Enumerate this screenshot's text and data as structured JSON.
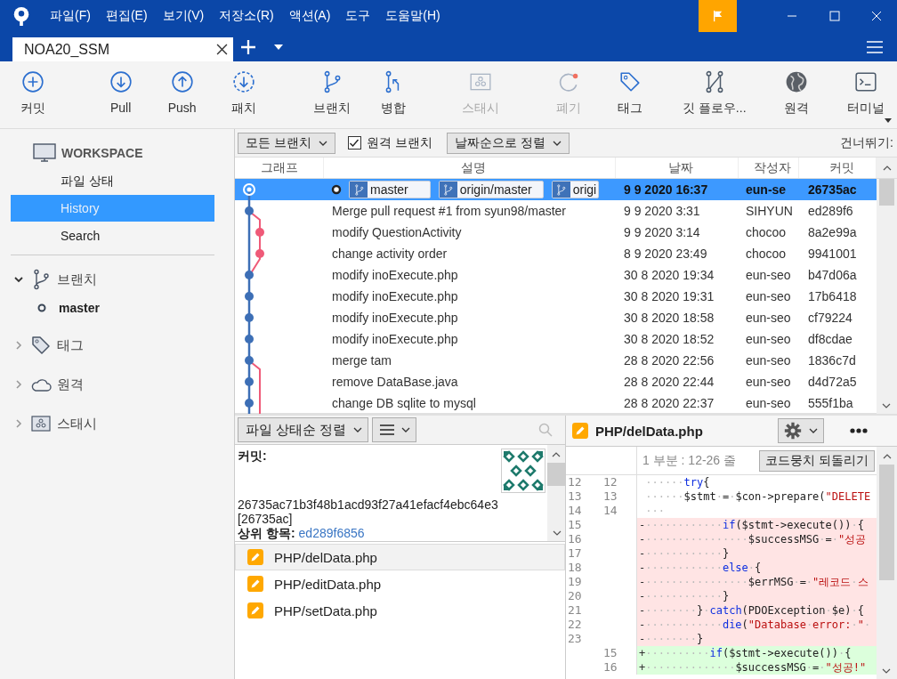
{
  "title_bar": {
    "menus": [
      "파일(F)",
      "편집(E)",
      "보기(V)",
      "저장소(R)",
      "액션(A)",
      "도구",
      "도움말(H)"
    ]
  },
  "tabs": [
    {
      "label": "NOA20_SSM",
      "selected": true
    }
  ],
  "toolbar": [
    {
      "kind": "commit",
      "label": "커밋",
      "disabled": false
    },
    {
      "kind": "pull",
      "label": "Pull",
      "disabled": false
    },
    {
      "kind": "push",
      "label": "Push",
      "disabled": false
    },
    {
      "kind": "patch",
      "label": "패치",
      "disabled": false
    },
    {
      "kind": "branch",
      "label": "브랜치",
      "disabled": false
    },
    {
      "kind": "merge",
      "label": "병합",
      "disabled": false
    },
    {
      "kind": "stash",
      "label": "스태시",
      "disabled": true
    },
    {
      "kind": "discard",
      "label": "폐기",
      "disabled": true
    },
    {
      "kind": "tag",
      "label": "태그",
      "disabled": false
    },
    {
      "kind": "gitflow",
      "label": "깃 플로우...",
      "disabled": false
    },
    {
      "kind": "remote",
      "label": "원격",
      "disabled": false
    },
    {
      "kind": "terminal",
      "label": "터미널",
      "disabled": false
    }
  ],
  "sidebar": {
    "workspace": {
      "title": "WORKSPACE",
      "items": [
        {
          "label": "파일 상태",
          "selected": false
        },
        {
          "label": "History",
          "selected": true
        },
        {
          "label": "Search",
          "selected": false
        }
      ]
    },
    "groups": [
      {
        "kind": "branches",
        "label": "브랜치",
        "expanded": true,
        "children": [
          {
            "label": "master",
            "current": true
          }
        ]
      },
      {
        "kind": "tags",
        "label": "태그",
        "expanded": false
      },
      {
        "kind": "remotes",
        "label": "원격",
        "expanded": false
      },
      {
        "kind": "stashes",
        "label": "스태시",
        "expanded": false
      }
    ]
  },
  "filter_bar": {
    "branch_filter": "모든 브랜치",
    "remote_branches": {
      "label": "원격 브랜치",
      "checked": true
    },
    "sort": "날짜순으로 정렬",
    "jump_label": "건너뛰기:"
  },
  "commit_table": {
    "columns": [
      "그래프",
      "설명",
      "날짜",
      "작성자",
      "커밋"
    ],
    "rows": [
      {
        "selected": true,
        "head": true,
        "refs": [
          "master",
          "origin/master",
          "origi"
        ],
        "date": "9 9 2020 16:37",
        "author": "eun-se",
        "commit": "26735ac"
      },
      {
        "selected": false,
        "description": "Merge pull request #1 from syun98/master",
        "date": "9 9 2020 3:31",
        "author": "SIHYUN",
        "commit": "ed289f6"
      },
      {
        "selected": false,
        "description": "modify QuestionActivity",
        "date": "9 9 2020 3:14",
        "author": "chocoo",
        "commit": "8a2e99a"
      },
      {
        "selected": false,
        "description": "change activity order",
        "date": "8 9 2020 23:49",
        "author": "chocoo",
        "commit": "9941001"
      },
      {
        "selected": false,
        "description": "modify inoExecute.php",
        "date": "30 8 2020 19:34",
        "author": "eun-seo",
        "commit": "b47d06a"
      },
      {
        "selected": false,
        "description": "modify inoExecute.php",
        "date": "30 8 2020 19:31",
        "author": "eun-seo",
        "commit": "17b6418"
      },
      {
        "selected": false,
        "description": "modify inoExecute.php",
        "date": "30 8 2020 18:58",
        "author": "eun-seo",
        "commit": "cf79224"
      },
      {
        "selected": false,
        "description": "modify inoExecute.php",
        "date": "30 8 2020 18:52",
        "author": "eun-seo",
        "commit": "df8cdae"
      },
      {
        "selected": false,
        "description": "merge tam",
        "date": "28 8 2020 22:56",
        "author": "eun-seo",
        "commit": "1836c7d"
      },
      {
        "selected": false,
        "description": "remove DataBase.java",
        "date": "28 8 2020 22:44",
        "author": "eun-seo",
        "commit": "d4d72a5"
      },
      {
        "selected": false,
        "description": "change DB sqlite to mysql",
        "date": "28 8 2020 22:37",
        "author": "eun-seo",
        "commit": "555f1ba"
      }
    ]
  },
  "details": {
    "sort": "파일 상태순 정렬",
    "commit_label": "커밋:",
    "hash": "26735ac71b3f48b1acd93f27a41efacf4ebc64e3 [26735ac]",
    "parent_label": "상위 항목:",
    "parent": "ed289f6856",
    "files": [
      {
        "path": "PHP/delData.php",
        "selected": true
      },
      {
        "path": "PHP/editData.php",
        "selected": false
      },
      {
        "path": "PHP/setData.php",
        "selected": false
      }
    ]
  },
  "diff": {
    "file": "PHP/delData.php",
    "hunk": "1 부분 : 12-26 줄",
    "revert_button": "코드뭉치 되돌리기",
    "lines": [
      {
        "kind": "context",
        "old": "12",
        "new": "12",
        "tokens": [
          {
            "text": "······",
            "kind": "plain"
          },
          {
            "text": "try",
            "kind": "keyword"
          },
          {
            "text": "{",
            "kind": "plain"
          }
        ]
      },
      {
        "kind": "context",
        "old": "13",
        "new": "13",
        "tokens": [
          {
            "text": "······$stmt·=·$con->prepare(",
            "kind": "plain"
          },
          {
            "text": "\"DELETE",
            "kind": "string"
          }
        ]
      },
      {
        "kind": "context",
        "old": "14",
        "new": "14",
        "tokens": [
          {
            "text": "···",
            "kind": "plain"
          }
        ]
      },
      {
        "kind": "removed",
        "old": "15",
        "sign": "-",
        "tokens": [
          {
            "text": "············",
            "kind": "plain"
          },
          {
            "text": "if",
            "kind": "keyword"
          },
          {
            "text": "($stmt->execute())·{",
            "kind": "plain"
          }
        ]
      },
      {
        "kind": "removed",
        "old": "16",
        "sign": "-",
        "tokens": [
          {
            "text": "················$successMSG·=·",
            "kind": "plain"
          },
          {
            "text": "\"성공",
            "kind": "string"
          }
        ]
      },
      {
        "kind": "removed",
        "old": "17",
        "sign": "-",
        "tokens": [
          {
            "text": "············}",
            "kind": "plain"
          }
        ]
      },
      {
        "kind": "removed",
        "old": "18",
        "sign": "-",
        "tokens": [
          {
            "text": "············",
            "kind": "plain"
          },
          {
            "text": "else",
            "kind": "keyword"
          },
          {
            "text": "·{",
            "kind": "plain"
          }
        ]
      },
      {
        "kind": "removed",
        "old": "19",
        "sign": "-",
        "tokens": [
          {
            "text": "················$errMSG·=·",
            "kind": "plain"
          },
          {
            "text": "\"레코드·스",
            "kind": "string"
          }
        ]
      },
      {
        "kind": "removed",
        "old": "20",
        "sign": "-",
        "tokens": [
          {
            "text": "············}",
            "kind": "plain"
          }
        ]
      },
      {
        "kind": "removed",
        "old": "21",
        "sign": "-",
        "tokens": [
          {
            "text": "········}·",
            "kind": "plain"
          },
          {
            "text": "catch",
            "kind": "keyword"
          },
          {
            "text": "(PDOException·$e)·{",
            "kind": "plain"
          }
        ]
      },
      {
        "kind": "removed",
        "old": "22",
        "sign": "-",
        "tokens": [
          {
            "text": "············",
            "kind": "plain"
          },
          {
            "text": "die",
            "kind": "keyword"
          },
          {
            "text": "(",
            "kind": "plain"
          },
          {
            "text": "\"Database·error:·\"",
            "kind": "string"
          },
          {
            "text": "·",
            "kind": "plain"
          }
        ]
      },
      {
        "kind": "removed",
        "old": "23",
        "sign": "-",
        "tokens": [
          {
            "text": "········}",
            "kind": "plain"
          }
        ]
      },
      {
        "kind": "added",
        "new": "15",
        "sign": "+",
        "tokens": [
          {
            "text": "··········",
            "kind": "plain"
          },
          {
            "text": "if",
            "kind": "keyword"
          },
          {
            "text": "($stmt->execute())·{",
            "kind": "plain"
          }
        ]
      },
      {
        "kind": "added",
        "new": "16",
        "sign": "+",
        "tokens": [
          {
            "text": "··············$successMSG·=·",
            "kind": "plain"
          },
          {
            "text": "\"성공!\"",
            "kind": "string"
          }
        ]
      }
    ]
  }
}
